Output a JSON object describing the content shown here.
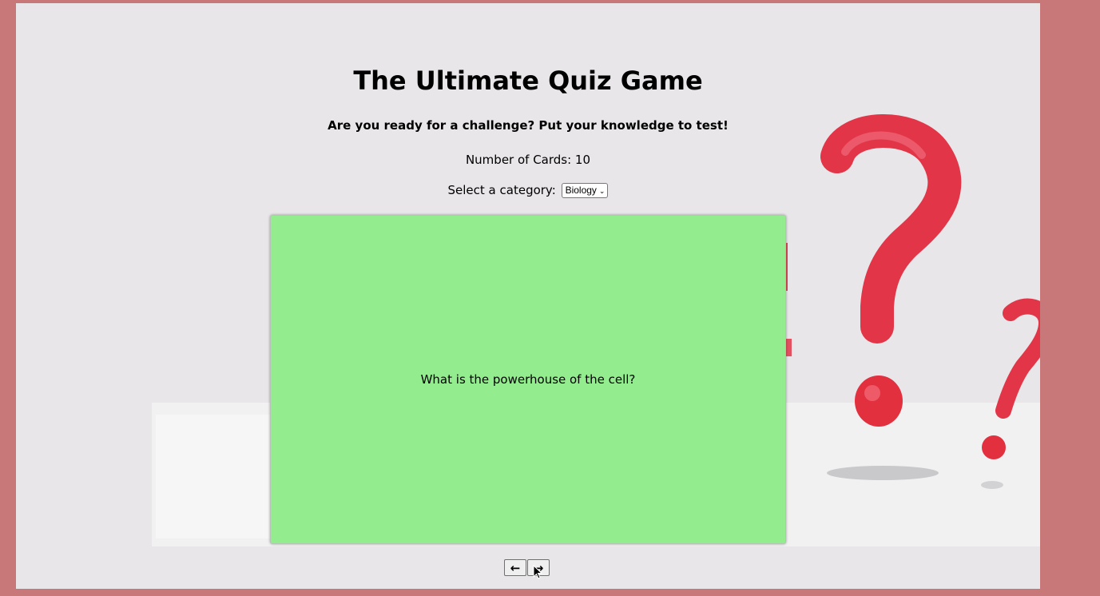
{
  "header": {
    "title": "The Ultimate Quiz Game",
    "subtitle": "Are you ready for a challenge? Put your knowledge to test!",
    "count_label": "Number of Cards: 10"
  },
  "category": {
    "label": "Select a category:",
    "selected": "Biology"
  },
  "card": {
    "question": "What is the powerhouse of the cell?",
    "color": "#93ec8e"
  },
  "nav": {
    "prev_icon": "←",
    "next_icon": "→"
  },
  "colors": {
    "outer_border": "#c87878",
    "page_bg": "#e8e6e8",
    "accent_red": "#e8344c"
  }
}
